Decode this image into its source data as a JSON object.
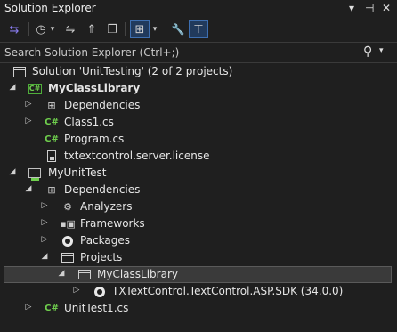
{
  "window": {
    "title": "Solution Explorer",
    "controls": [
      "▾",
      "⊣",
      "✕"
    ]
  },
  "toolbar": {
    "items": [
      {
        "icon": "sync-view-icon",
        "glyph": "⇆"
      },
      {
        "icon": "history-icon",
        "glyph": "◷"
      },
      {
        "icon": "dropdown-icon",
        "glyph": "▾"
      },
      {
        "icon": "pending-changes-icon",
        "glyph": "⇋"
      },
      {
        "icon": "collapse-all-icon",
        "glyph": "⇑"
      },
      {
        "icon": "copy-icon",
        "glyph": "❐"
      },
      {
        "icon": "show-all-files-icon",
        "glyph": "⊞"
      },
      {
        "icon": "dropdown-icon-2",
        "glyph": "▾"
      },
      {
        "icon": "properties-icon",
        "glyph": "🔧"
      },
      {
        "icon": "preview-icon",
        "glyph": "⊤"
      }
    ]
  },
  "search": {
    "placeholder": "Search Solution Explorer (Ctrl+;)",
    "icon": "search-icon"
  },
  "tree": [
    {
      "label": "Solution 'UnitTesting' (2 of 2 projects)",
      "icon": "solution-icon",
      "expander": "",
      "bold": false
    },
    {
      "label": "MyClassLibrary",
      "icon": "csharp-project-icon",
      "expander": "◢",
      "bold": true
    },
    {
      "label": "Dependencies",
      "icon": "dependencies-icon",
      "expander": "▷",
      "bold": false
    },
    {
      "label": "Class1.cs",
      "icon": "csharp-file-icon",
      "expander": "▷",
      "bold": false
    },
    {
      "label": "Program.cs",
      "icon": "csharp-file-icon",
      "expander": "",
      "bold": false
    },
    {
      "label": "txtextcontrol.server.license",
      "icon": "license-file-icon",
      "expander": "",
      "bold": false
    },
    {
      "label": "MyUnitTest",
      "icon": "test-project-icon",
      "expander": "◢",
      "bold": false
    },
    {
      "label": "Dependencies",
      "icon": "dependencies-icon",
      "expander": "◢",
      "bold": false
    },
    {
      "label": "Analyzers",
      "icon": "analyzers-icon",
      "expander": "▷",
      "bold": false
    },
    {
      "label": "Frameworks",
      "icon": "frameworks-icon",
      "expander": "▷",
      "bold": false
    },
    {
      "label": "Packages",
      "icon": "packages-icon",
      "expander": "▷",
      "bold": false
    },
    {
      "label": "Projects",
      "icon": "projects-folder-icon",
      "expander": "◢",
      "bold": false
    },
    {
      "label": "MyClassLibrary",
      "icon": "project-reference-icon",
      "expander": "◢",
      "bold": false,
      "selected": true
    },
    {
      "label": "TXTextControl.TextControl.ASP.SDK (34.0.0)",
      "icon": "package-icon",
      "expander": "▷",
      "bold": false
    },
    {
      "label": "UnitTest1.cs",
      "icon": "csharp-file-icon",
      "expander": "▷",
      "bold": false
    }
  ],
  "colors": {
    "background": "#1f1f1f",
    "csharp": "#6fcf4d",
    "selection": "#3a3a3a",
    "toolbar_toggle": "#213a5c"
  }
}
